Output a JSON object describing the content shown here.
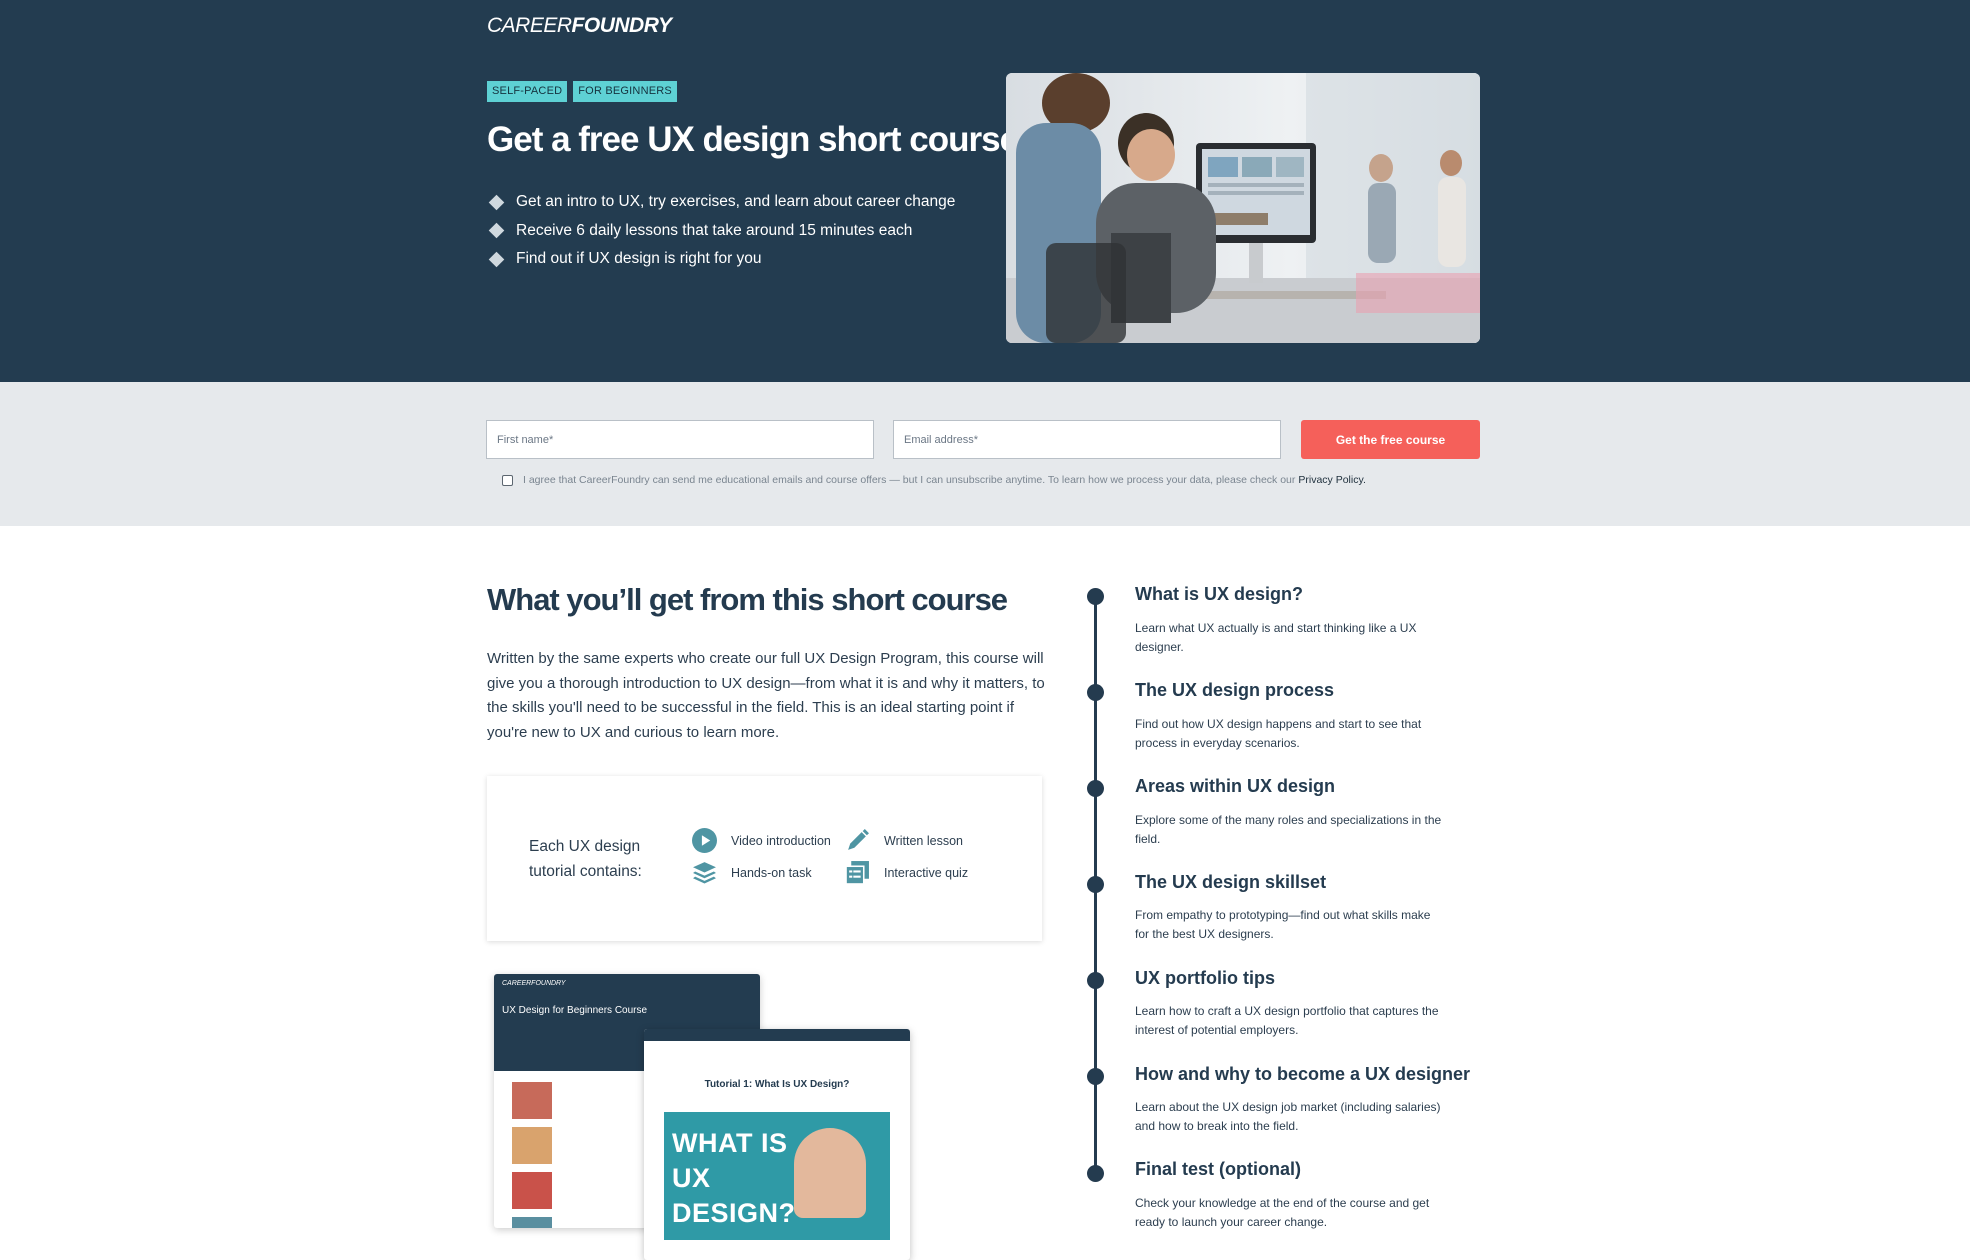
{
  "header": {
    "logo_part1": "CAREER",
    "logo_part2": "FOUNDRY"
  },
  "hero": {
    "tags": [
      "SELF-PACED",
      "FOR BEGINNERS"
    ],
    "title": "Get a free UX design short course",
    "bullets": [
      "Get an intro to UX, try exercises, and learn about career change",
      "Receive 6 daily lessons that take around 15 minutes each",
      "Find out if UX design is right for you"
    ]
  },
  "form": {
    "first_name_placeholder": "First name*",
    "email_placeholder": "Email address*",
    "submit_label": "Get the free course",
    "consent_text": "I agree that CareerFoundry can send me educational emails and course offers — but I can unsubscribe anytime. To learn how we process your data, please check our",
    "privacy_link": "Privacy Policy."
  },
  "course": {
    "title": "What you’ll get from this short course",
    "body": "Written by the same experts who create our full UX Design Program, this course will give you a thorough introduction to UX design—from what it is and why it matters, to the skills you'll need to be successful in the field. This is an ideal starting point if you're new to UX and curious to learn more.",
    "contains_label": "Each UX design tutorial contains:",
    "contents": {
      "video": "Video introduction",
      "written": "Written lesson",
      "task": "Hands-on task",
      "quiz": "Interactive quiz"
    }
  },
  "mockup": {
    "back_logo": "CAREERFOUNDRY",
    "back_title": "UX Design for Beginners Course",
    "front_title": "Tutorial 1: What Is UX Design?",
    "video_text_1": "WHAT IS",
    "video_text_2": "UX",
    "video_text_3": "DESIGN?"
  },
  "timeline": [
    {
      "title": "What is UX design?",
      "desc": "Learn what UX actually is and start thinking like a UX designer."
    },
    {
      "title": "The UX design process",
      "desc": "Find out how UX design happens and start to see that process in everyday scenarios."
    },
    {
      "title": "Areas within UX design",
      "desc": "Explore some of the many roles and specializations in the field."
    },
    {
      "title": "The UX design skillset",
      "desc": "From empathy to prototyping—find out what skills make for the best UX designers."
    },
    {
      "title": "UX portfolio tips",
      "desc": "Learn how to craft a UX design portfolio that captures the interest of potential employers."
    },
    {
      "title": "How and why to become a UX designer",
      "desc": "Learn about the UX design job market (including salaries) and how to break into the field."
    },
    {
      "title": "Final test (optional)",
      "desc": "Check your knowledge at the end of the course and get ready to launch your career change."
    }
  ],
  "colors": {
    "hero_bg": "#233c50",
    "tag_bg": "#5ed1d4",
    "cta_bg": "#f5605a",
    "form_band_bg": "#e6e9ec",
    "icon_teal": "#4f95a3"
  }
}
